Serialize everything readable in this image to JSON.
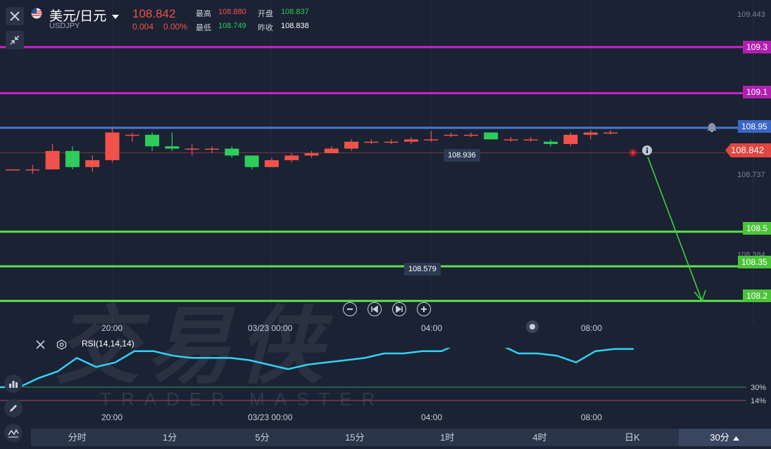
{
  "header": {
    "title": "美元/日元",
    "symbol": "USDJPY",
    "price": "108.842",
    "change": "0.004",
    "change_pct": "0.00%",
    "high_label": "最高",
    "high_value": "108.880",
    "open_label": "开盘",
    "open_value": "108.837",
    "low_label": "最低",
    "low_value": "108.749",
    "prev_close_label": "昨收",
    "prev_close_value": "108.838"
  },
  "levels": [
    {
      "label": "109.3",
      "color": "#cc22cc"
    },
    {
      "label": "109.1",
      "color": "#cc22cc"
    },
    {
      "label": "108.95",
      "color": "#4a78d6"
    },
    {
      "label": "108.5",
      "color": "#5fe04a"
    },
    {
      "label": "108.35",
      "color": "#5fe04a"
    },
    {
      "label": "108.2",
      "color": "#5fe04a"
    }
  ],
  "price_axis": {
    "top": "109.443",
    "current": "108.842",
    "mid": "108.737",
    "lower": "108.384"
  },
  "callouts": {
    "high": "108.936",
    "low": "108.579"
  },
  "time_labels": [
    "20:00",
    "03/23 00:00",
    "04:00",
    "08:00"
  ],
  "rsi": {
    "label": "RSI(14,14,14)",
    "level_30": "30%",
    "level_14": "14%"
  },
  "watermark": {
    "cn": "交易侠",
    "en": "TRADER MASTER"
  },
  "timeframes": [
    "分时",
    "1分",
    "5分",
    "15分",
    "1时",
    "4时",
    "日K",
    "30分"
  ],
  "active_timeframe": "30分",
  "colors": {
    "up": "#f0524a",
    "down": "#2ecc5a",
    "rsi_line": "#2fd3f0",
    "background": "#1a2233"
  },
  "icons": [
    "close-icon",
    "us-flag-icon",
    "dropdown-caret-icon",
    "collapse-icon",
    "bell-icon",
    "info-icon",
    "zoom-out-icon",
    "rewind-icon",
    "forward-icon",
    "zoom-in-icon",
    "indicator-icon",
    "pencil-icon",
    "wave-icon",
    "settings-icon"
  ],
  "chart_data": {
    "type": "candlestick",
    "ylim": [
      108.14,
      109.443
    ],
    "candles": [
      {
        "o": 108.77,
        "c": 108.77,
        "h": 108.77,
        "l": 108.77
      },
      {
        "o": 108.77,
        "c": 108.77,
        "h": 108.79,
        "l": 108.75
      },
      {
        "o": 108.77,
        "c": 108.85,
        "h": 108.88,
        "l": 108.77
      },
      {
        "o": 108.85,
        "c": 108.78,
        "h": 108.87,
        "l": 108.77
      },
      {
        "o": 108.78,
        "c": 108.81,
        "h": 108.83,
        "l": 108.76
      },
      {
        "o": 108.81,
        "c": 108.93,
        "h": 108.95,
        "l": 108.8
      },
      {
        "o": 108.92,
        "c": 108.92,
        "h": 108.93,
        "l": 108.89
      },
      {
        "o": 108.92,
        "c": 108.87,
        "h": 108.93,
        "l": 108.85
      },
      {
        "o": 108.87,
        "c": 108.86,
        "h": 108.93,
        "l": 108.85
      },
      {
        "o": 108.86,
        "c": 108.86,
        "h": 108.88,
        "l": 108.83
      },
      {
        "o": 108.86,
        "c": 108.86,
        "h": 108.87,
        "l": 108.84
      },
      {
        "o": 108.86,
        "c": 108.83,
        "h": 108.87,
        "l": 108.82
      },
      {
        "o": 108.83,
        "c": 108.78,
        "h": 108.83,
        "l": 108.77
      },
      {
        "o": 108.78,
        "c": 108.81,
        "h": 108.82,
        "l": 108.78
      },
      {
        "o": 108.81,
        "c": 108.83,
        "h": 108.84,
        "l": 108.8
      },
      {
        "o": 108.83,
        "c": 108.84,
        "h": 108.85,
        "l": 108.82
      },
      {
        "o": 108.84,
        "c": 108.86,
        "h": 108.87,
        "l": 108.84
      },
      {
        "o": 108.86,
        "c": 108.89,
        "h": 108.9,
        "l": 108.85
      },
      {
        "o": 108.89,
        "c": 108.89,
        "h": 108.9,
        "l": 108.88
      },
      {
        "o": 108.89,
        "c": 108.89,
        "h": 108.9,
        "l": 108.88
      },
      {
        "o": 108.89,
        "c": 108.9,
        "h": 108.91,
        "l": 108.88
      },
      {
        "o": 108.9,
        "c": 108.9,
        "h": 108.936,
        "l": 108.89
      },
      {
        "o": 108.92,
        "c": 108.92,
        "h": 108.93,
        "l": 108.91
      },
      {
        "o": 108.92,
        "c": 108.92,
        "h": 108.93,
        "l": 108.91
      },
      {
        "o": 108.93,
        "c": 108.9,
        "h": 108.93,
        "l": 108.9
      },
      {
        "o": 108.9,
        "c": 108.9,
        "h": 108.91,
        "l": 108.89
      },
      {
        "o": 108.9,
        "c": 108.9,
        "h": 108.91,
        "l": 108.89
      },
      {
        "o": 108.89,
        "c": 108.88,
        "h": 108.9,
        "l": 108.87
      },
      {
        "o": 108.88,
        "c": 108.92,
        "h": 108.93,
        "l": 108.87
      },
      {
        "o": 108.92,
        "c": 108.93,
        "h": 108.94,
        "l": 108.9
      },
      {
        "o": 108.93,
        "c": 108.93,
        "h": 108.94,
        "l": 108.92
      }
    ],
    "rsi_values": [
      48,
      48,
      52,
      55,
      61,
      57,
      59,
      64,
      64,
      62,
      61,
      61,
      61,
      60,
      58,
      56,
      58,
      59,
      60,
      61,
      63,
      63,
      64,
      64,
      68,
      68,
      67,
      63,
      63,
      62,
      59,
      64,
      65,
      65
    ]
  }
}
